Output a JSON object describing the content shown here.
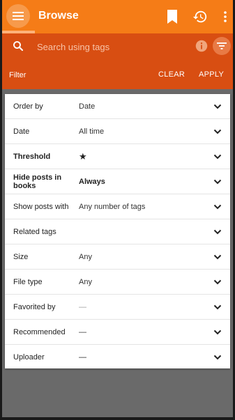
{
  "appbar": {
    "title": "Browse",
    "color": "#f57c17",
    "menu_icon": "menu-icon",
    "bookmark_icon": "bookmark-icon",
    "history_icon": "history-icon",
    "more_icon": "more-vert-icon"
  },
  "search": {
    "placeholder": "Search using tags",
    "value": "",
    "background": "#d84e12"
  },
  "filter_bar": {
    "label": "Filter",
    "clear_label": "CLEAR",
    "apply_label": "APPLY"
  },
  "filters": [
    {
      "label": "Order by",
      "value": "Date"
    },
    {
      "label": "Date",
      "value": "All time"
    },
    {
      "label": "Threshold",
      "value": "★"
    },
    {
      "label": "Hide posts in books",
      "value": "Always"
    },
    {
      "label": "Show posts with",
      "value": "Any number of tags"
    },
    {
      "label": "Related tags",
      "value": ""
    },
    {
      "label": "Size",
      "value": "Any"
    },
    {
      "label": "File type",
      "value": "Any"
    },
    {
      "label": "Favorited by",
      "value": "—"
    },
    {
      "label": "Recommended",
      "value": "—"
    },
    {
      "label": "Uploader",
      "value": "—"
    }
  ]
}
